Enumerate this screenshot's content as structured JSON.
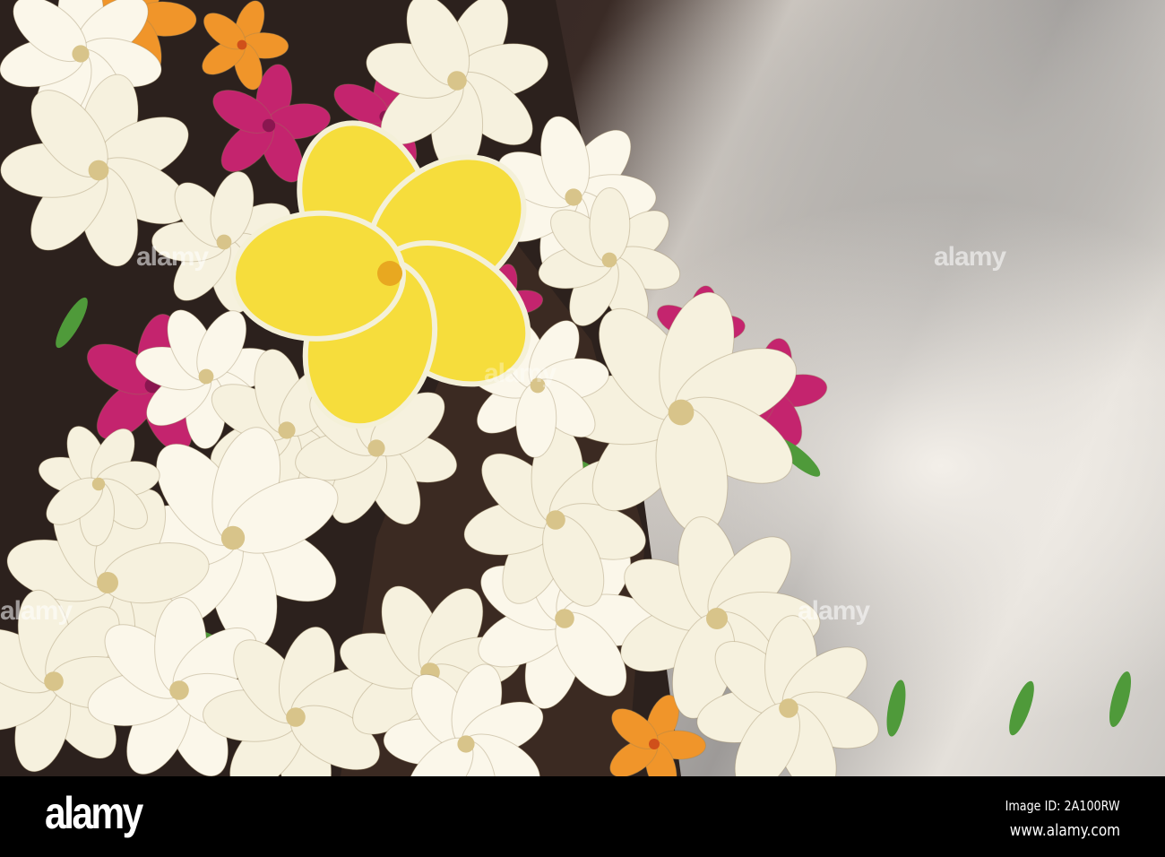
{
  "watermark": {
    "text": "alamy"
  },
  "footer": {
    "logo": "alamy",
    "image_id": "Image ID: 2A100RW",
    "url": "www.alamy.com"
  }
}
